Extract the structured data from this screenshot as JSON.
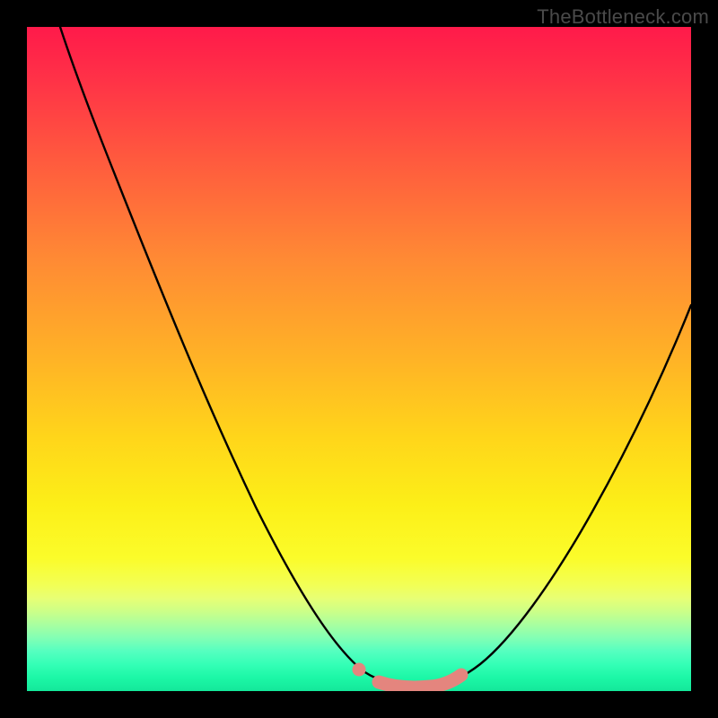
{
  "watermark": "TheBottleneck.com",
  "chart_data": {
    "type": "line",
    "title": "",
    "xlabel": "",
    "ylabel": "",
    "xlim": [
      0,
      100
    ],
    "ylim": [
      0,
      100
    ],
    "grid": false,
    "legend": false,
    "series": [
      {
        "name": "bottleneck-curve",
        "x": [
          5,
          10,
          15,
          20,
          25,
          30,
          35,
          40,
          44,
          48,
          50,
          52,
          55,
          58,
          60,
          63,
          66,
          70,
          75,
          80,
          85,
          90,
          95,
          100
        ],
        "y": [
          100,
          88,
          76,
          64,
          52,
          41,
          30,
          20,
          12,
          6,
          3,
          1,
          0,
          0,
          0,
          1,
          3,
          7,
          13,
          21,
          30,
          40,
          51,
          62
        ]
      }
    ],
    "annotations": [
      {
        "name": "bottom-pink-segment",
        "type": "marker-band",
        "color": "#e4857e",
        "x_range": [
          50,
          64
        ],
        "y_approx": 2
      }
    ],
    "colors": {
      "curve": "#000000",
      "marker": "#e4857e",
      "gradient_top": "#ff1a4a",
      "gradient_mid": "#ffd61a",
      "gradient_bottom": "#14e89a",
      "frame": "#000000"
    }
  }
}
